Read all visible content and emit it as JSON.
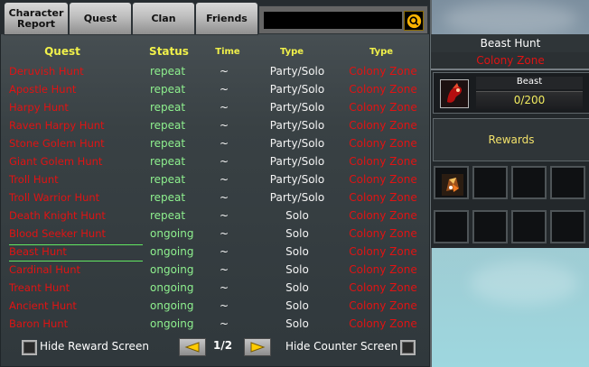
{
  "tabs": [
    {
      "label_line1": "Character",
      "label_line2": "Report"
    },
    {
      "label": "Quest"
    },
    {
      "label": "Clan"
    },
    {
      "label": "Friends"
    }
  ],
  "search": {
    "value": "",
    "placeholder": ""
  },
  "table": {
    "headers": {
      "quest": "Quest",
      "status": "Status",
      "time": "Time",
      "type1": "Type",
      "type2": "Type"
    },
    "rows": [
      {
        "quest": "Deruvish Hunt",
        "status": "repeat",
        "time": "~",
        "type": "Party/Solo",
        "zone": "Colony Zone"
      },
      {
        "quest": "Apostle Hunt",
        "status": "repeat",
        "time": "~",
        "type": "Party/Solo",
        "zone": "Colony Zone"
      },
      {
        "quest": "Harpy Hunt",
        "status": "repeat",
        "time": "~",
        "type": "Party/Solo",
        "zone": "Colony Zone"
      },
      {
        "quest": "Raven Harpy Hunt",
        "status": "repeat",
        "time": "~",
        "type": "Party/Solo",
        "zone": "Colony Zone"
      },
      {
        "quest": "Stone Golem Hunt",
        "status": "repeat",
        "time": "~",
        "type": "Party/Solo",
        "zone": "Colony Zone"
      },
      {
        "quest": "Giant Golem Hunt",
        "status": "repeat",
        "time": "~",
        "type": "Party/Solo",
        "zone": "Colony Zone"
      },
      {
        "quest": "Troll Hunt",
        "status": "repeat",
        "time": "~",
        "type": "Party/Solo",
        "zone": "Colony Zone"
      },
      {
        "quest": "Troll Warrior Hunt",
        "status": "repeat",
        "time": "~",
        "type": "Party/Solo",
        "zone": "Colony Zone"
      },
      {
        "quest": "Death Knight Hunt",
        "status": "repeat",
        "time": "~",
        "type": "Solo",
        "zone": "Colony Zone"
      },
      {
        "quest": "Blood Seeker Hunt",
        "status": "ongoing",
        "time": "~",
        "type": "Solo",
        "zone": "Colony Zone"
      },
      {
        "quest": "Beast Hunt",
        "status": "ongoing",
        "time": "~",
        "type": "Solo",
        "zone": "Colony Zone"
      },
      {
        "quest": "Cardinal Hunt",
        "status": "ongoing",
        "time": "~",
        "type": "Solo",
        "zone": "Colony Zone"
      },
      {
        "quest": "Treant Hunt",
        "status": "ongoing",
        "time": "~",
        "type": "Solo",
        "zone": "Colony Zone"
      },
      {
        "quest": "Ancient Hunt",
        "status": "ongoing",
        "time": "~",
        "type": "Solo",
        "zone": "Colony Zone"
      },
      {
        "quest": "Baron Hunt",
        "status": "ongoing",
        "time": "~",
        "type": "Solo",
        "zone": "Colony Zone"
      }
    ]
  },
  "footer": {
    "hide_reward_label": "Hide Reward Screen",
    "hide_counter_label": "Hide Counter Screen",
    "page": "1/2",
    "prev_icon": "left-triangle-arrow",
    "next_icon": "right-triangle-arrow"
  },
  "detail": {
    "title": "Beast Hunt",
    "zone": "Colony Zone",
    "counter_label": "Beast",
    "counter_value": "0/200",
    "rewards_label": "Rewards",
    "monster_icon": "beast-monster-icon",
    "reward_icon": "reward-item-icon"
  },
  "colors": {
    "red_text": "#e01313",
    "green_status": "#8ef08e",
    "yellow_header": "#f1f14a",
    "gold_counter": "#f2ec5f"
  }
}
